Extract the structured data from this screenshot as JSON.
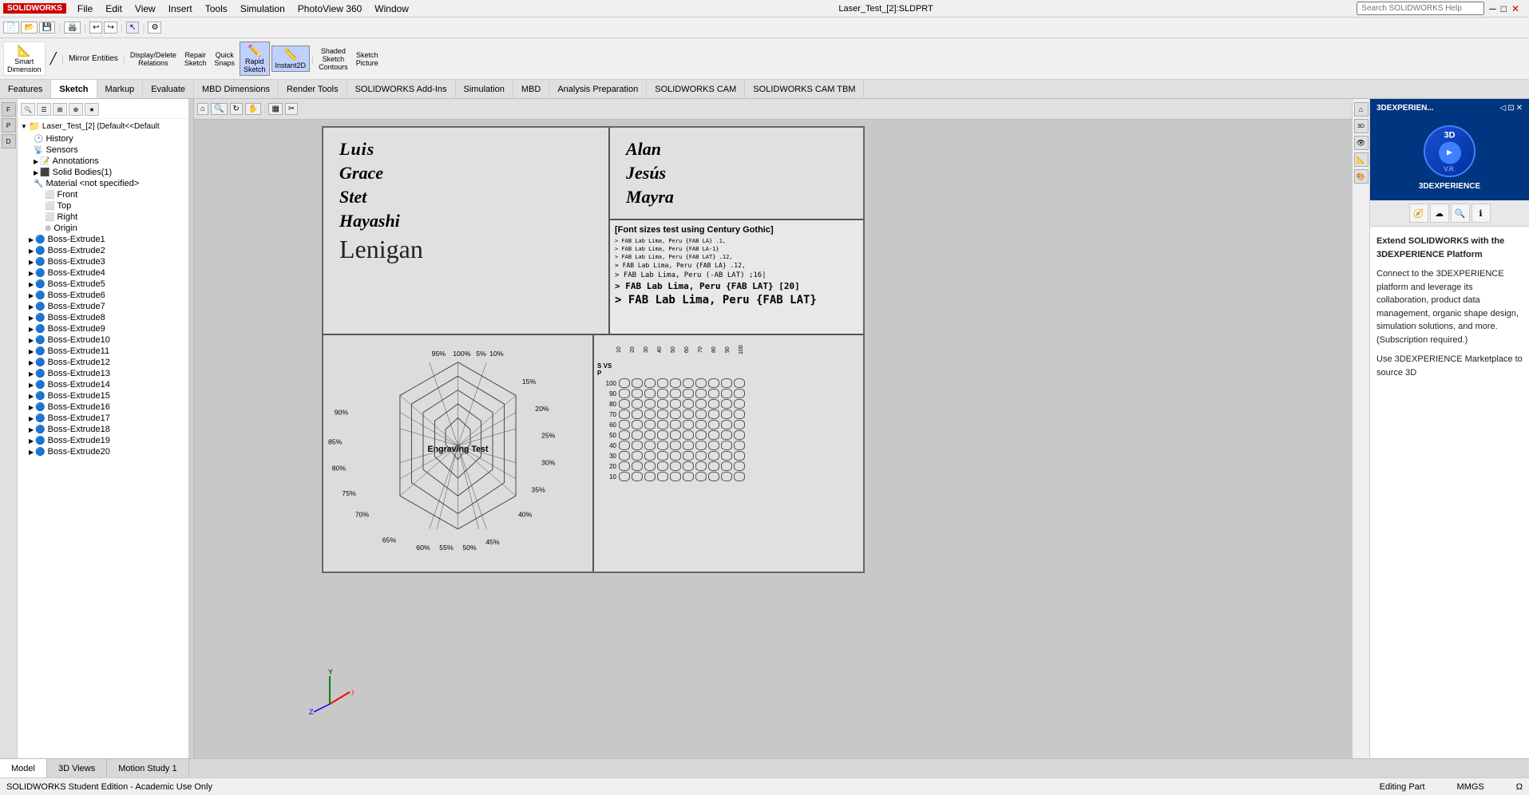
{
  "topbar": {
    "logo": "SOLIDWORKS",
    "menus": [
      "File",
      "Edit",
      "View",
      "Insert",
      "Tools",
      "Simulation",
      "PhotoView 360",
      "Window"
    ],
    "title": "Laser_Test_[2]:SLDPRT",
    "search_placeholder": "Search SOLIDWORKS Help"
  },
  "tabs": [
    "Features",
    "Sketch",
    "Markup",
    "Evaluate",
    "MBD Dimensions",
    "Render Tools",
    "SOLIDWORKS Add-Ins",
    "Simulation",
    "MBD",
    "Analysis Preparation",
    "SOLIDWORKS CAM",
    "SOLIDWORKS CAM TBM"
  ],
  "active_tab": "Sketch",
  "sidebar": {
    "root_item": "Laser_Test_[2] (Default<<Default",
    "items": [
      {
        "id": "history",
        "label": "History",
        "level": 1,
        "hasArrow": false
      },
      {
        "id": "sensors",
        "label": "Sensors",
        "level": 1,
        "hasArrow": false
      },
      {
        "id": "annotations",
        "label": "Annotations",
        "level": 1,
        "hasArrow": false
      },
      {
        "id": "solid-bodies",
        "label": "Solid Bodies(1)",
        "level": 1,
        "hasArrow": false
      },
      {
        "id": "material",
        "label": "Material <not specified>",
        "level": 1,
        "hasArrow": false
      },
      {
        "id": "front",
        "label": "Front",
        "level": 2,
        "hasArrow": false
      },
      {
        "id": "top",
        "label": "Top",
        "level": 2,
        "hasArrow": false
      },
      {
        "id": "right",
        "label": "Right",
        "level": 2,
        "hasArrow": false
      },
      {
        "id": "origin",
        "label": "Origin",
        "level": 2,
        "hasArrow": false
      },
      {
        "id": "boss-extrude1",
        "label": "Boss-Extrude1",
        "level": 1,
        "hasArrow": true
      },
      {
        "id": "boss-extrude2",
        "label": "Boss-Extrude2",
        "level": 1,
        "hasArrow": true
      },
      {
        "id": "boss-extrude3",
        "label": "Boss-Extrude3",
        "level": 1,
        "hasArrow": true
      },
      {
        "id": "boss-extrude4",
        "label": "Boss-Extrude4",
        "level": 1,
        "hasArrow": true
      },
      {
        "id": "boss-extrude5",
        "label": "Boss-Extrude5",
        "level": 1,
        "hasArrow": true
      },
      {
        "id": "boss-extrude6",
        "label": "Boss-Extrude6",
        "level": 1,
        "hasArrow": true
      },
      {
        "id": "boss-extrude7",
        "label": "Boss-Extrude7",
        "level": 1,
        "hasArrow": true
      },
      {
        "id": "boss-extrude8",
        "label": "Boss-Extrude8",
        "level": 1,
        "hasArrow": true
      },
      {
        "id": "boss-extrude9",
        "label": "Boss-Extrude9",
        "level": 1,
        "hasArrow": true
      },
      {
        "id": "boss-extrude10",
        "label": "Boss-Extrude10",
        "level": 1,
        "hasArrow": true
      },
      {
        "id": "boss-extrude11",
        "label": "Boss-Extrude11",
        "level": 1,
        "hasArrow": true
      },
      {
        "id": "boss-extrude12",
        "label": "Boss-Extrude12",
        "level": 1,
        "hasArrow": true
      },
      {
        "id": "boss-extrude13",
        "label": "Boss-Extrude13",
        "level": 1,
        "hasArrow": true
      },
      {
        "id": "boss-extrude14",
        "label": "Boss-Extrude14",
        "level": 1,
        "hasArrow": true
      },
      {
        "id": "boss-extrude15",
        "label": "Boss-Extrude15",
        "level": 1,
        "hasArrow": true
      },
      {
        "id": "boss-extrude16",
        "label": "Boss-Extrude16",
        "level": 1,
        "hasArrow": true
      },
      {
        "id": "boss-extrude17",
        "label": "Boss-Extrude17",
        "level": 1,
        "hasArrow": true
      },
      {
        "id": "boss-extrude18",
        "label": "Boss-Extrude18",
        "level": 1,
        "hasArrow": true
      },
      {
        "id": "boss-extrude19",
        "label": "Boss-Extrude19",
        "level": 1,
        "hasArrow": true
      },
      {
        "id": "boss-extrude20",
        "label": "Boss-Extrude20",
        "level": 1,
        "hasArrow": true
      }
    ]
  },
  "sketch": {
    "title_font_test": "[Font sizes test using Century Gothic]",
    "names_left": [
      "Luis",
      "Grace",
      "Stet",
      "Hayashi",
      "Lenigan"
    ],
    "names_right": [
      "Alan",
      "Jesús",
      "Mayra"
    ],
    "font_samples": [
      "> FAB Lab Lima, Peru {FAB LA} .12,",
      "> FAB Lab Lima, Peru (-AB LAT) ;16|",
      "> FAB Lab Lima, Peru {FAB LAT} [20]",
      "> FAB Lab Lima, Peru {FAB LAT}"
    ],
    "engraving_test_label": "Engraving Test",
    "percentages_outer": [
      "95%",
      "100%",
      "5%",
      "10%",
      "15%",
      "20%",
      "25%",
      "30%",
      "35%",
      "40%",
      "45%",
      "50%",
      "55%",
      "60%",
      "65%",
      "70%",
      "75%",
      "80%",
      "85%",
      "90%"
    ],
    "svsp_label": "S VS P",
    "svsp_rows": [
      100,
      90,
      80,
      70,
      60,
      50,
      40,
      30,
      20,
      10
    ],
    "svsp_cols": [
      10,
      20,
      30,
      40,
      50,
      60,
      70,
      80,
      90,
      100
    ]
  },
  "right_panel": {
    "brand": "3DEXPERIEN...",
    "brand_full": "3DEXPERIENCE",
    "vr_label": "V.R.",
    "heading": "Extend SOLIDWORKS with the 3DEXPERIENCE Platform",
    "connect_text": "Connect to the 3DEXPERIENCE platform and leverage its collaboration, product data management, organic shape design, simulation solutions, and more. (Subscription required.)",
    "use_text": "Use 3DEXPERIENCE Marketplace to source 3D"
  },
  "bottom_tabs": [
    "Model",
    "3D Views",
    "Motion Study 1"
  ],
  "active_bottom_tab": "Model",
  "status": {
    "left": "SOLIDWORKS Student Edition - Academic Use Only",
    "editing": "Editing Part",
    "units": "MMGS",
    "symbol": "Ω"
  }
}
